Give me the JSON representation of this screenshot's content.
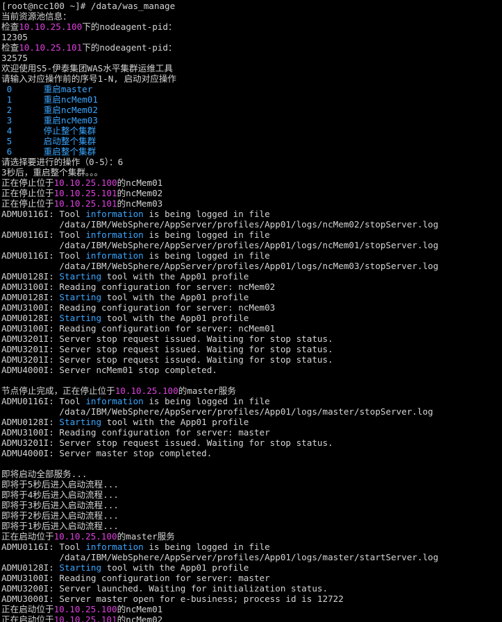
{
  "terminal": {
    "colors": {
      "background": "#000000",
      "text": "#d4d4d4",
      "ip": "#e040e0",
      "keyword": "#3aa6ff",
      "menu": "#3aa6ff"
    },
    "lines": [
      [
        {
          "t": "[root@ncc100 ~]# /data/was_manage",
          "c": "n"
        }
      ],
      [
        {
          "t": "当前资源池信息：",
          "c": "n"
        }
      ],
      [
        {
          "t": "检查",
          "c": "n"
        },
        {
          "t": "10.10.25.100",
          "c": "ip"
        },
        {
          "t": "下的nodeagent-pid：",
          "c": "n"
        }
      ],
      [
        {
          "t": "12305",
          "c": "n"
        }
      ],
      [
        {
          "t": "检查",
          "c": "n"
        },
        {
          "t": "10.10.25.101",
          "c": "ip"
        },
        {
          "t": "下的nodeagent-pid：",
          "c": "n"
        }
      ],
      [
        {
          "t": "32575",
          "c": "n"
        }
      ],
      [
        {
          "t": "欢迎使用S5-伊泰集团WAS水平集群运维工具",
          "c": "n"
        }
      ],
      [
        {
          "t": "请输入对应操作前的序号1-N, 启动对应操作",
          "c": "n"
        }
      ],
      [
        {
          "t": " 0      重启master",
          "c": "menu"
        }
      ],
      [
        {
          "t": " 1      重启ncMem01",
          "c": "menu"
        }
      ],
      [
        {
          "t": " 2      重启ncMem02",
          "c": "menu"
        }
      ],
      [
        {
          "t": " 3      重启ncMem03",
          "c": "menu"
        }
      ],
      [
        {
          "t": " 4      停止整个集群",
          "c": "menu"
        }
      ],
      [
        {
          "t": " 5      启动整个集群",
          "c": "menu"
        }
      ],
      [
        {
          "t": " 6      重启整个集群",
          "c": "menu"
        }
      ],
      [
        {
          "t": "请选择要进行的操作（0-5）：6",
          "c": "n"
        }
      ],
      [
        {
          "t": "3秒后，重启整个集群。。。",
          "c": "n"
        }
      ],
      [
        {
          "t": "正在停止位于",
          "c": "n"
        },
        {
          "t": "10.10.25.100",
          "c": "ip"
        },
        {
          "t": "的ncMem01",
          "c": "n"
        }
      ],
      [
        {
          "t": "正在停止位于",
          "c": "n"
        },
        {
          "t": "10.10.25.101",
          "c": "ip"
        },
        {
          "t": "的ncMem02",
          "c": "n"
        }
      ],
      [
        {
          "t": "正在停止位于",
          "c": "n"
        },
        {
          "t": "10.10.25.101",
          "c": "ip"
        },
        {
          "t": "的ncMem03",
          "c": "n"
        }
      ],
      [
        {
          "t": "ADMU0116I: Tool ",
          "c": "n"
        },
        {
          "t": "information",
          "c": "kw"
        },
        {
          "t": " is being logged in file",
          "c": "n"
        }
      ],
      [
        {
          "t": "           /data/IBM/WebSphere/AppServer/profiles/App01/logs/ncMem02/stopServer.log",
          "c": "n"
        }
      ],
      [
        {
          "t": "ADMU0116I: Tool ",
          "c": "n"
        },
        {
          "t": "information",
          "c": "kw"
        },
        {
          "t": " is being logged in file",
          "c": "n"
        }
      ],
      [
        {
          "t": "           /data/IBM/WebSphere/AppServer/profiles/App01/logs/ncMem01/stopServer.log",
          "c": "n"
        }
      ],
      [
        {
          "t": "ADMU0116I: Tool ",
          "c": "n"
        },
        {
          "t": "information",
          "c": "kw"
        },
        {
          "t": " is being logged in file",
          "c": "n"
        }
      ],
      [
        {
          "t": "           /data/IBM/WebSphere/AppServer/profiles/App01/logs/ncMem03/stopServer.log",
          "c": "n"
        }
      ],
      [
        {
          "t": "ADMU0128I: ",
          "c": "n"
        },
        {
          "t": "Starting",
          "c": "kw"
        },
        {
          "t": " tool with the App01 profile",
          "c": "n"
        }
      ],
      [
        {
          "t": "ADMU3100I: Reading configuration for server: ncMem02",
          "c": "n"
        }
      ],
      [
        {
          "t": "ADMU0128I: ",
          "c": "n"
        },
        {
          "t": "Starting",
          "c": "kw"
        },
        {
          "t": " tool with the App01 profile",
          "c": "n"
        }
      ],
      [
        {
          "t": "ADMU3100I: Reading configuration for server: ncMem03",
          "c": "n"
        }
      ],
      [
        {
          "t": "ADMU0128I: ",
          "c": "n"
        },
        {
          "t": "Starting",
          "c": "kw"
        },
        {
          "t": " tool with the App01 profile",
          "c": "n"
        }
      ],
      [
        {
          "t": "ADMU3100I: Reading configuration for server: ncMem01",
          "c": "n"
        }
      ],
      [
        {
          "t": "ADMU3201I: Server stop request issued. Waiting for stop status.",
          "c": "n"
        }
      ],
      [
        {
          "t": "ADMU3201I: Server stop request issued. Waiting for stop status.",
          "c": "n"
        }
      ],
      [
        {
          "t": "ADMU3201I: Server stop request issued. Waiting for stop status.",
          "c": "n"
        }
      ],
      [
        {
          "t": "ADMU4000I: Server ncMem01 stop completed.",
          "c": "n"
        }
      ],
      [
        {
          "t": "",
          "c": "n"
        }
      ],
      [
        {
          "t": "节点停止完成，正在停止位于",
          "c": "n"
        },
        {
          "t": "10.10.25.100",
          "c": "ip"
        },
        {
          "t": "的master服务",
          "c": "n"
        }
      ],
      [
        {
          "t": "ADMU0116I: Tool ",
          "c": "n"
        },
        {
          "t": "information",
          "c": "kw"
        },
        {
          "t": " is being logged in file",
          "c": "n"
        }
      ],
      [
        {
          "t": "           /data/IBM/WebSphere/AppServer/profiles/App01/logs/master/stopServer.log",
          "c": "n"
        }
      ],
      [
        {
          "t": "ADMU0128I: ",
          "c": "n"
        },
        {
          "t": "Starting",
          "c": "kw"
        },
        {
          "t": " tool with the App01 profile",
          "c": "n"
        }
      ],
      [
        {
          "t": "ADMU3100I: Reading configuration for server: master",
          "c": "n"
        }
      ],
      [
        {
          "t": "ADMU3201I: Server stop request issued. Waiting for stop status.",
          "c": "n"
        }
      ],
      [
        {
          "t": "ADMU4000I: Server master stop completed.",
          "c": "n"
        }
      ],
      [
        {
          "t": "",
          "c": "n"
        }
      ],
      [
        {
          "t": "即将启动全部服务...",
          "c": "n"
        }
      ],
      [
        {
          "t": "即将于5秒后进入启动流程...",
          "c": "n"
        }
      ],
      [
        {
          "t": "即将于4秒后进入启动流程...",
          "c": "n"
        }
      ],
      [
        {
          "t": "即将于3秒后进入启动流程...",
          "c": "n"
        }
      ],
      [
        {
          "t": "即将于2秒后进入启动流程...",
          "c": "n"
        }
      ],
      [
        {
          "t": "即将于1秒后进入启动流程...",
          "c": "n"
        }
      ],
      [
        {
          "t": "正在启动位于",
          "c": "n"
        },
        {
          "t": "10.10.25.100",
          "c": "ip"
        },
        {
          "t": "的master服务",
          "c": "n"
        }
      ],
      [
        {
          "t": "ADMU0116I: Tool ",
          "c": "n"
        },
        {
          "t": "information",
          "c": "kw"
        },
        {
          "t": " is being logged in file",
          "c": "n"
        }
      ],
      [
        {
          "t": "           /data/IBM/WebSphere/AppServer/profiles/App01/logs/master/startServer.log",
          "c": "n"
        }
      ],
      [
        {
          "t": "ADMU0128I: ",
          "c": "n"
        },
        {
          "t": "Starting",
          "c": "kw"
        },
        {
          "t": " tool with the App01 profile",
          "c": "n"
        }
      ],
      [
        {
          "t": "ADMU3100I: Reading configuration for server: master",
          "c": "n"
        }
      ],
      [
        {
          "t": "ADMU3200I: Server launched. Waiting for initialization status.",
          "c": "n"
        }
      ],
      [
        {
          "t": "ADMU3000I: Server master open for e-business; process id is 12722",
          "c": "n"
        }
      ],
      [
        {
          "t": "正在启动位于",
          "c": "n"
        },
        {
          "t": "10.10.25.100",
          "c": "ip"
        },
        {
          "t": "的ncMem01",
          "c": "n"
        }
      ],
      [
        {
          "t": "正在启动位于",
          "c": "n"
        },
        {
          "t": "10.10.25.101",
          "c": "ip"
        },
        {
          "t": "的ncMem02",
          "c": "n"
        }
      ]
    ]
  }
}
